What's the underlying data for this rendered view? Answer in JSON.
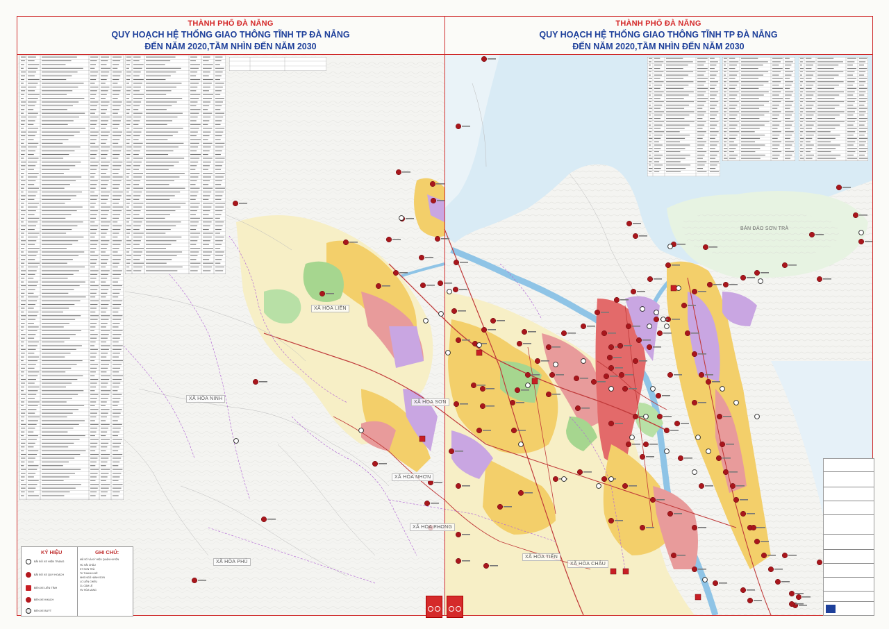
{
  "titles": {
    "left": {
      "city": "THÀNH PHỐ ĐÀ NẴNG",
      "main": "QUY HOẠCH HỆ THỐNG GIAO THÔNG TĨNH TP ĐÀ NẴNG",
      "sub": "ĐẾN NĂM 2020,TẦM NHÌN ĐẾN NĂM 2030"
    },
    "right": {
      "city": "THÀNH PHỐ ĐÀ NẴNG",
      "main": "QUY HOẠCH HỆ THỐNG GIAO THÔNG TĨNH TP ĐÀ NẴNG",
      "sub": "ĐẾN NĂM 2020,TẦM NHÌN ĐẾN NĂM 2030"
    }
  },
  "map_labels": {
    "hoa_lien": "XÃ HÒA LIÊN",
    "hoa_ninh": "XÃ HÒA NINH",
    "hoa_son": "XÃ HÒA SƠN",
    "hoa_nhon": "XÃ HÒA NHƠN",
    "hoa_phong": "XÃ HÒA PHONG",
    "hoa_phu": "XÃ HÒA PHÚ",
    "hoa_tien": "XÃ HÒA TIẾN",
    "hoa_chau": "XÃ HÒA CHÂU",
    "son_tra": "BÁN ĐẢO SƠN TRÀ"
  },
  "legend": {
    "title": "KÝ HIỆU",
    "items": [
      "BÃI ĐỖ XE HIỆN TRẠNG",
      "BÃI ĐỖ XE QUY HOẠCH",
      "BẾN XE LIÊN TỈNH",
      "BẾN XE KHÁCH",
      "BẾN XE BUÝT"
    ]
  },
  "notes": {
    "title": "GHI CHÚ:",
    "heading": "MÃ SỐ VÀ KÝ HIỆU QUẬN HUYỆN",
    "items": [
      "HC  HẢI CHÂU",
      "ST  SƠN TRÀ",
      "TK  THANH KHÊ",
      "NHS NGŨ HÀNH SƠN",
      "LC  LIÊN CHIỂU",
      "CL  CẨM LỆ",
      "HV  HÒA VANG"
    ]
  },
  "colors": {
    "frame": "#cf2b2b",
    "parking": "#b3181e",
    "river": "#8fc4e6",
    "sea": "#c9e3f2",
    "residential": "#f5d35c",
    "commercial": "#e36a6a",
    "green": "#9fd28a",
    "institutional": "#c7a6e0",
    "road": "#d83a3a"
  },
  "icons": [
    "parking-existing-icon",
    "parking-planned-icon",
    "intercity-bus-station-icon",
    "coach-station-icon",
    "bus-station-icon"
  ]
}
